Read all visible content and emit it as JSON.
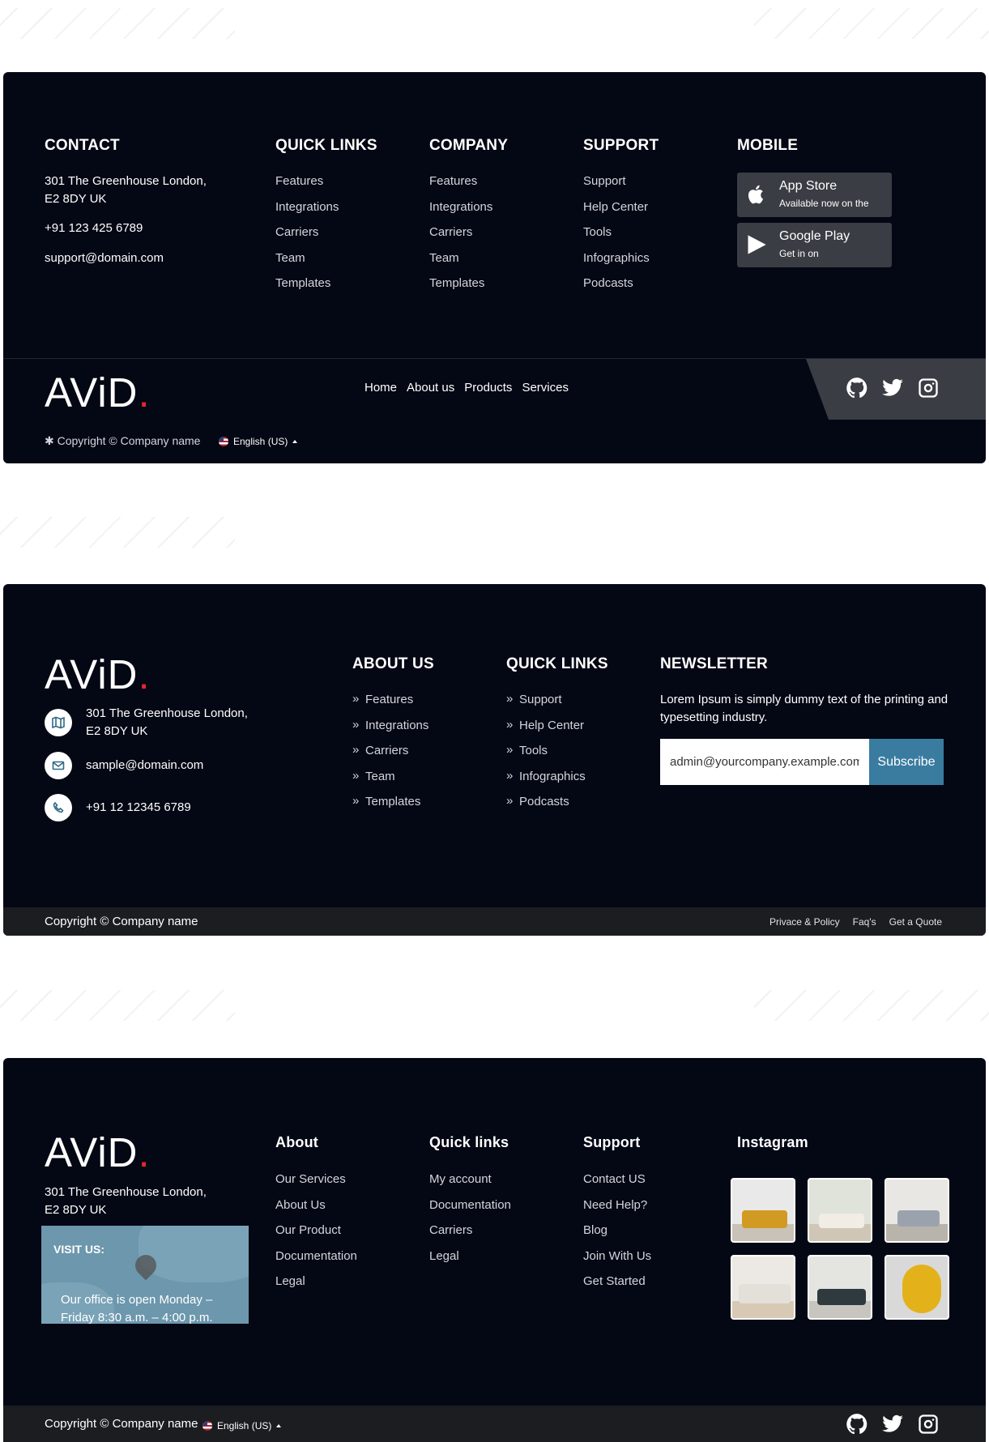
{
  "footer1": {
    "contact": {
      "title": "CONTACT",
      "address_line1": "301 The Greenhouse London,",
      "address_line2": "E2 8DY UK",
      "phone": "+91 123 425 6789",
      "email": "support@domain.com"
    },
    "quick_links": {
      "title": "QUICK LINKS",
      "items": [
        "Features",
        "Integrations",
        "Carriers",
        "Team",
        "Templates"
      ]
    },
    "company": {
      "title": "COMPANY",
      "items": [
        "Features",
        "Integrations",
        "Carriers",
        "Team",
        "Templates"
      ]
    },
    "support": {
      "title": "SUPPORT",
      "items": [
        "Support",
        "Help Center",
        "Tools",
        "Infographics",
        "Podcasts"
      ]
    },
    "mobile": {
      "title": "MOBILE",
      "app_store": {
        "title": "App Store",
        "subtitle": "Available now on the"
      },
      "google_play": {
        "title": "Google Play",
        "subtitle": "Get in on"
      }
    },
    "logo": {
      "text": "AViD",
      "dot": "."
    },
    "nav": [
      "Home",
      "About us",
      "Products",
      "Services"
    ],
    "copyright": "Copyright © Company name",
    "language": "English (US)",
    "social_icons": [
      "github-icon",
      "twitter-icon",
      "instagram-icon"
    ]
  },
  "footer2": {
    "logo": {
      "text": "AViD",
      "dot": "."
    },
    "address_line1": "301 The Greenhouse London,",
    "address_line2": "E2 8DY UK",
    "email": "sample@domain.com",
    "phone": "+91 12 12345 6789",
    "about": {
      "title": "ABOUT US",
      "items": [
        "Features",
        "Integrations",
        "Carriers",
        "Team",
        "Templates"
      ]
    },
    "quick_links": {
      "title": "QUICK LINKS",
      "items": [
        "Support",
        "Help Center",
        "Tools",
        "Infographics",
        "Podcasts"
      ]
    },
    "newsletter": {
      "title": "NEWSLETTER",
      "text": "Lorem Ipsum is simply dummy text of the printing and typesetting industry.",
      "input_value": "admin@yourcompany.example.com",
      "button": "Subscribe"
    },
    "copyright": "Copyright © Company name",
    "bottom_links": [
      "Privace & Policy",
      "Faq's",
      "Get a Quote"
    ]
  },
  "footer3": {
    "logo": {
      "text": "AViD",
      "dot": "."
    },
    "address_line1": "301 The Greenhouse London,",
    "address_line2": "E2 8DY UK",
    "map": {
      "label": "VISIT US:",
      "line1": "Our office is open Monday –",
      "line2": "Friday 8:30 a.m. – 4:00 p.m."
    },
    "about": {
      "title": "About",
      "items": [
        "Our Services",
        "About Us",
        "Our Product",
        "Documentation",
        "Legal"
      ]
    },
    "quick_links": {
      "title": "Quick links",
      "items": [
        "My account",
        "Documentation",
        "Carriers",
        "Legal"
      ]
    },
    "support": {
      "title": "Support",
      "items": [
        "Contact US",
        "Need Help?",
        "Blog",
        "Join With Us",
        "Get Started"
      ]
    },
    "instagram": {
      "title": "Instagram"
    },
    "copyright": "Copyright © Company name",
    "language": "English (US)"
  },
  "colors": {
    "background": "#040714",
    "accent": "#3a7ca0",
    "logo_dot": "#e3262f",
    "band": "#3a3d44"
  }
}
